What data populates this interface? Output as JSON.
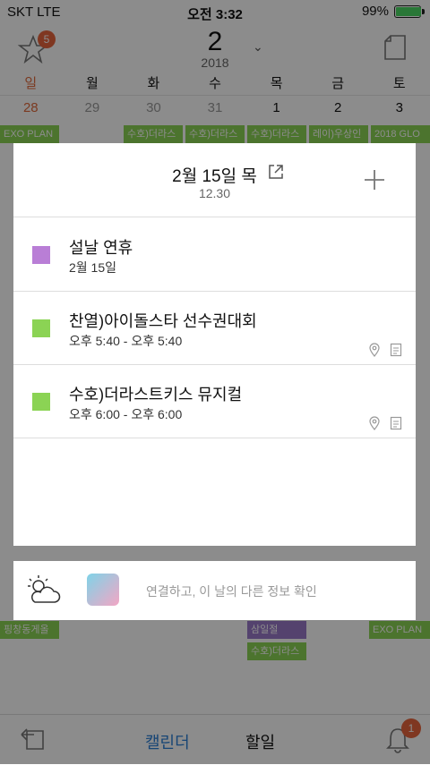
{
  "status": {
    "carrier": "SKT  LTE",
    "time": "오전 3:32",
    "battery": "99%",
    "battery_level": 0.99
  },
  "header": {
    "star_badge": "5",
    "month": "2",
    "year": "2018"
  },
  "weekdays": [
    "일",
    "월",
    "화",
    "수",
    "목",
    "금",
    "토"
  ],
  "dates": [
    "28",
    "29",
    "30",
    "31",
    "1",
    "2",
    "3"
  ],
  "background_events": {
    "row1": [
      "EXO PLAN",
      "수호)더라스",
      "수호)더라스",
      "수호)더라스",
      "레이)우상인",
      "2018 GLO"
    ],
    "row_bottom": [
      "핑창동게올",
      "삼일절",
      "수호)더라스",
      "EXO PLAN"
    ]
  },
  "modal": {
    "title": "2월 15일 목",
    "subtitle": "12.30",
    "items": [
      {
        "title": "설날 연휴",
        "time": "2월 15일",
        "color": "#b97ed6"
      },
      {
        "title": "찬열)아이돌스타 선수권대회",
        "time": "오후 5:40 - 오후 5:40",
        "color": "#8bd354"
      },
      {
        "title": "수호)더라스트키스 뮤지컬",
        "time": "오후 6:00 - 오후 6:00",
        "color": "#8bd354"
      }
    ]
  },
  "infobar": {
    "text": "연결하고, 이 날의 다른 정보 확인"
  },
  "bottombar": {
    "calendar_label": "캘린더",
    "todo_label": "할일",
    "bell_badge": "1"
  },
  "colors": {
    "accent": "#2a7fd6",
    "badge": "#e8643c",
    "sunday": "#e06a3c"
  },
  "icons": [
    "star-icon",
    "chevron-down-icon",
    "document-icon",
    "external-link-icon",
    "plus-icon",
    "location-pin-icon",
    "note-icon",
    "weather-icon",
    "back-arrow-icon",
    "bell-icon"
  ]
}
